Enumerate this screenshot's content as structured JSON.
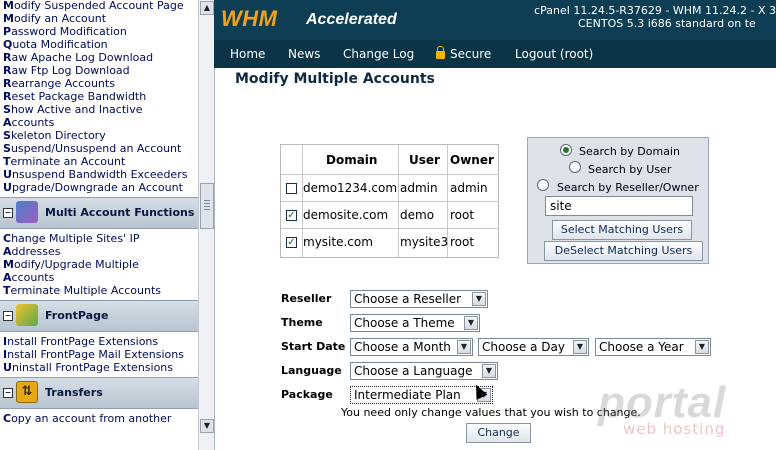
{
  "sidebar": {
    "group1_links": [
      "Modify Suspended Account Page",
      "Modify an Account",
      "Password Modification",
      "Quota Modification",
      "Raw Apache Log Download",
      "Raw Ftp Log Download",
      "Rearrange Accounts",
      "Reset Package Bandwidth",
      "Show Active and Inactive",
      "Accounts",
      "Skeleton Directory",
      "Suspend/Unsuspend an Account",
      "Terminate an Account",
      "Unsuspend Bandwidth Exceeders",
      "Upgrade/Downgrade an Account"
    ],
    "section_multi": "Multi Account Functions",
    "group2_links": [
      "Change Multiple Sites' IP",
      "Addresses",
      "Modify/Upgrade Multiple",
      "Accounts",
      "Terminate Multiple Accounts"
    ],
    "section_frontpage": "FrontPage",
    "group3_links": [
      "Install FrontPage Extensions",
      "Install FrontPage Mail Extensions",
      "Uninstall FrontPage Extensions"
    ],
    "section_transfers": "Transfers",
    "group4_links": [
      "Copy an account from another"
    ]
  },
  "header": {
    "logo": "WHM",
    "logo_sub": "Accelerated",
    "version_line1": "cPanel 11.24.5-R37629 - WHM 11.24.2 - X 3",
    "version_line2": "CENTOS 5.3 i686 standard on te"
  },
  "nav": {
    "home": "Home",
    "news": "News",
    "changelog": "Change Log",
    "secure": "Secure",
    "logout": "Logout (root)"
  },
  "main": {
    "title": "Modify Multiple Accounts",
    "table": {
      "headers": [
        "Domain",
        "User",
        "Owner"
      ],
      "rows": [
        {
          "domain": "demo1234.com",
          "user": "admin",
          "owner": "admin",
          "checked": false
        },
        {
          "domain": "demosite.com",
          "user": "demo",
          "owner": "root",
          "checked": true
        },
        {
          "domain": "mysite.com",
          "user": "mysite3",
          "owner": "root",
          "checked": true
        }
      ]
    },
    "search": {
      "by_domain": "Search by Domain",
      "by_user": "Search by User",
      "by_reseller": "Search by Reseller/Owner",
      "input_value": "site",
      "select_btn": "Select Matching Users",
      "deselect_btn": "DeSelect Matching Users"
    },
    "form": {
      "reseller_label": "Reseller",
      "reseller_value": "Choose a Reseller",
      "theme_label": "Theme",
      "theme_value": "Choose a Theme",
      "start_date_label": "Start Date",
      "month_value": "Choose a Month",
      "day_value": "Choose a Day",
      "year_value": "Choose a Year",
      "language_label": "Language",
      "language_value": "Choose a Language",
      "package_label": "Package",
      "package_value": "Intermediate Plan"
    },
    "note": "You need only change values that you wish to change.",
    "change_btn": "Change"
  },
  "watermark": {
    "brand": "portal",
    "sub": "web hosting"
  },
  "colors": {
    "header_bg": "#0d3e53",
    "logo_orange": "#f5a21a",
    "link_blue": "#000c5c"
  }
}
